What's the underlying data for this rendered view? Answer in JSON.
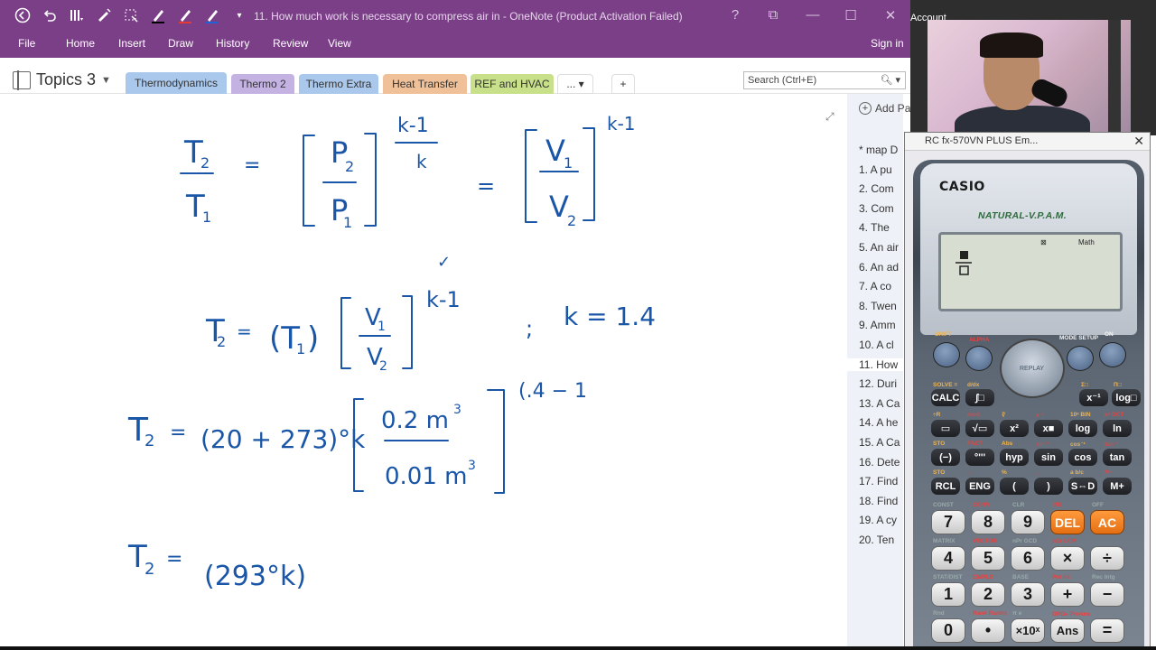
{
  "window": {
    "title": "11. How much work is necessary to compress air in  - OneNote (Product Activation Failed)",
    "controls": [
      "?",
      "⧉",
      "—",
      "☐",
      "✕"
    ]
  },
  "menu": {
    "file": "File",
    "home": "Home",
    "insert": "Insert",
    "draw": "Draw",
    "history": "History",
    "review": "Review",
    "view": "View",
    "signin": "Sign in"
  },
  "notebook": {
    "name": "Topics 3"
  },
  "sections": [
    {
      "label": "Thermodynamics",
      "color": "#a9c8ec"
    },
    {
      "label": "Thermo 2",
      "color": "#c4b2e3"
    },
    {
      "label": "Thermo Extra",
      "color": "#a9c8ec"
    },
    {
      "label": "Heat Transfer",
      "color": "#f0c199"
    },
    {
      "label": "REF and HVAC",
      "color": "#c8e08a"
    },
    {
      "label": "...",
      "color": "#ffffff"
    },
    {
      "label": "+",
      "color": "#ffffff"
    }
  ],
  "search": {
    "placeholder": "Search (Ctrl+E)"
  },
  "pages": {
    "add_label": "Add Pa",
    "items": [
      "* map D",
      "1. A pu",
      "2. Com",
      "3. Com",
      "4. The",
      "5. An air",
      "6. An ad",
      "7. A co",
      "8. Twen",
      "9. Amm",
      "10. A cl",
      "11. How",
      "12. Duri",
      "13. A Ca",
      "14. A he",
      "15. A Ca",
      "16. Dete",
      "17. Find",
      "18. Find",
      "19. A cy",
      "20. Ten"
    ],
    "selected_index": 11
  },
  "handwriting": {
    "T2": "T",
    "sub2": "2",
    "T1": "T",
    "sub1": "1",
    "P2": "P",
    "P1": "P",
    "km1": "k-1",
    "k": "k",
    "V1": "V",
    "V2": "V",
    "eq": "=",
    "semi": ";",
    "kval": "k = 1.4",
    "exp2": "k-1",
    "T1paren": "(T",
    "exp3": "(.4 − 1",
    "sum": "(20 + 273)°k",
    "num": "0.2 m",
    "den": "0.01 m",
    "cube": "3",
    "res": "(293°k)",
    "check": "✓"
  },
  "background_window": {
    "account_label": "Account"
  },
  "calculator": {
    "window_title": "RC fx-570VN PLUS Em...",
    "brand": "CASIO",
    "tagline": "NATURAL-V.P.A.M.",
    "lcd": {
      "indicator1": "⊠",
      "indicator2": "Math"
    },
    "replay": "REPLAY",
    "top_labels": [
      "SHIFT",
      "ALPHA",
      "MODE SETUP",
      "ON"
    ],
    "func_rows": [
      [
        "CALC",
        "∫□",
        "x⁻¹",
        "log□"
      ],
      [
        "▭",
        "√▭",
        "x²",
        "x■",
        "log",
        "ln"
      ],
      [
        "(−)",
        "°'''",
        "hyp",
        "sin",
        "cos",
        "tan"
      ],
      [
        "RCL",
        "ENG",
        "(",
        ")",
        "S⇔D",
        "M+"
      ]
    ],
    "num_rows": [
      [
        "7",
        "8",
        "9",
        "DEL",
        "AC"
      ],
      [
        "4",
        "5",
        "6",
        "×",
        "÷"
      ],
      [
        "1",
        "2",
        "3",
        "+",
        "−"
      ],
      [
        "0",
        "•",
        "×10ˣ",
        "Ans",
        "="
      ]
    ],
    "sub_labels": {
      "r1": [
        "SOLVE =",
        "d/dx",
        "x!",
        "Σ□",
        "Π□"
      ],
      "r2": [
        "÷R",
        "mod",
        "∛",
        "x⁻¹",
        "10ˣ BIN",
        "eˣ OCT"
      ],
      "r3": [
        "STO",
        "FACT",
        "Abs",
        "sin⁻¹",
        "cos⁻¹",
        "tan⁻¹"
      ],
      "r4": [
        "STO",
        "←",
        "%",
        ",",
        "a b/c",
        "M−"
      ],
      "r5": [
        "CONST",
        "CONV",
        "CLR",
        "INS",
        "OFF"
      ],
      "r6": [
        "MATRIX",
        "VECTOR",
        "nPr GCD",
        "nCr LCM"
      ],
      "r7": [
        "STAT/DIST",
        "CMPLX",
        "BASE",
        "Pol Int",
        "Rec Intg"
      ],
      "r8": [
        "Rnd",
        "Ran# RanInt",
        "π e",
        "DRG▸ PreAns"
      ]
    }
  },
  "colors": {
    "title_bg": "#7b3f88",
    "ink": "#1a56a8"
  }
}
